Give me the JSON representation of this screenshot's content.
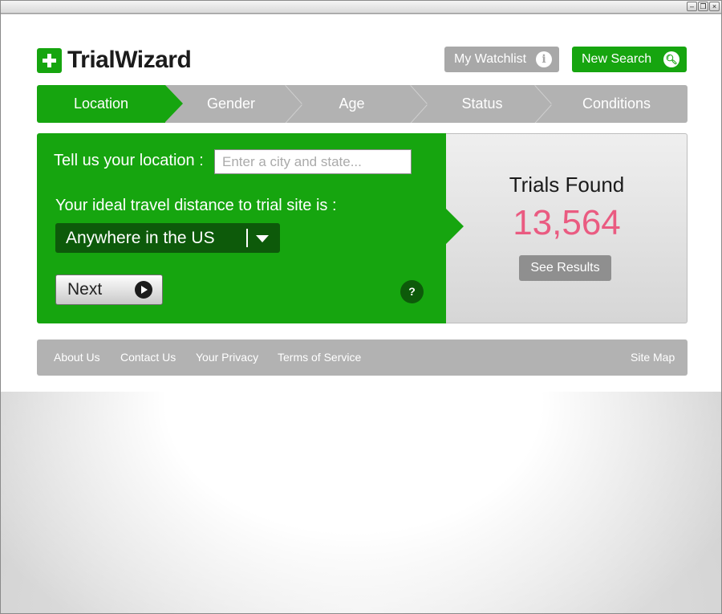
{
  "window": {
    "controls": [
      "minimize",
      "restore",
      "close"
    ]
  },
  "brand": {
    "name": "TrialWizard",
    "color": "#16a50f"
  },
  "header": {
    "watchlist_label": "My Watchlist",
    "watchlist_icon": "info-icon",
    "new_search_label": "New Search",
    "new_search_icon": "search-icon"
  },
  "steps": [
    {
      "label": "Location",
      "active": true
    },
    {
      "label": "Gender",
      "active": false
    },
    {
      "label": "Age",
      "active": false
    },
    {
      "label": "Status",
      "active": false
    },
    {
      "label": "Conditions",
      "active": false
    }
  ],
  "form": {
    "location_label": "Tell us your location :",
    "location_placeholder": "Enter a city and state...",
    "location_value": "",
    "distance_label": "Your ideal travel distance to trial site is :",
    "distance_selected": "Anywhere in the US",
    "next_label": "Next",
    "help_glyph": "?"
  },
  "results": {
    "label": "Trials Found",
    "count": "13,564",
    "count_color": "#ea5b81",
    "button_label": "See Results"
  },
  "footer": {
    "links": [
      "About Us",
      "Contact Us",
      "Your Privacy",
      "Terms of Service"
    ],
    "sitemap": "Site Map"
  }
}
